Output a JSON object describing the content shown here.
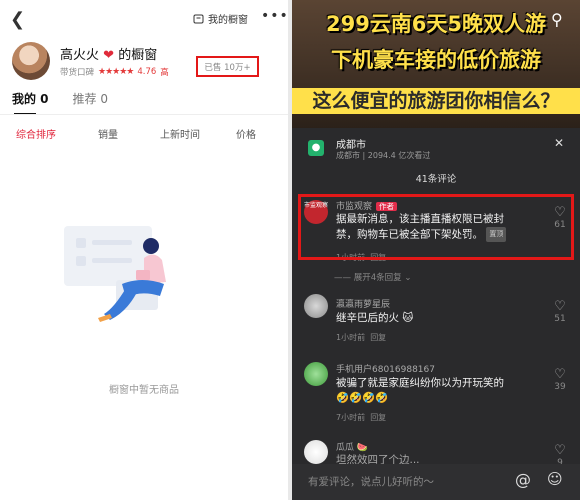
{
  "left": {
    "my_window": "我的橱窗",
    "shop_name": "高火火",
    "shop_suffix": "的橱窗",
    "rating_label": "带货口碑",
    "rating_score": "4.76",
    "rating_level": "高",
    "sold": "已售 10万+",
    "tabs": [
      {
        "label": "我的 0"
      },
      {
        "label": "推荐 0"
      }
    ],
    "sort": [
      "综合排序",
      "销量",
      "上新时间",
      "价格"
    ],
    "empty_text": "橱窗中暂无商品"
  },
  "right": {
    "banner": {
      "line1": "299云南6天5晚双人游",
      "line2": "下机豪车接的低价旅游",
      "line3": "这么便宜的旅游团你相信么？"
    },
    "location": {
      "title": "成都市",
      "subtitle": "成都市 | 2094.4 亿次看过"
    },
    "comment_count": "41条评论",
    "comments": [
      {
        "name": "市监观察",
        "tag": "作者",
        "text_line1": "据最新消息，该主播直播权限已被封",
        "text_line2": "禁，购物车已被全部下架处罚。",
        "chip": "置顶",
        "time": "1小时前",
        "reply": "回复",
        "likes": "61",
        "avatar_text": "市监观察"
      },
      {
        "name": "瀛瀛雨萝星辰",
        "text_line1": "继辛巴后的火",
        "time": "1小时前",
        "reply": "回复",
        "likes": "51"
      },
      {
        "name": "手机用户68016988167",
        "text_line1": "被骗了就是家庭纠纷你以为开玩笑的",
        "text_line2": "🤣🤣🤣🤣",
        "time": "7小时前",
        "reply": "回复",
        "likes": "39"
      },
      {
        "name": "瓜瓜",
        "text_line1": "坦然效四了个边...",
        "likes": "9"
      }
    ],
    "expand": "展开4条回复",
    "input_placeholder": "有爱评论，说点儿好听的～"
  },
  "colors": {
    "accent_red": "#e31818",
    "banner_yellow": "#ffe04a",
    "location_green": "#23b26d"
  }
}
